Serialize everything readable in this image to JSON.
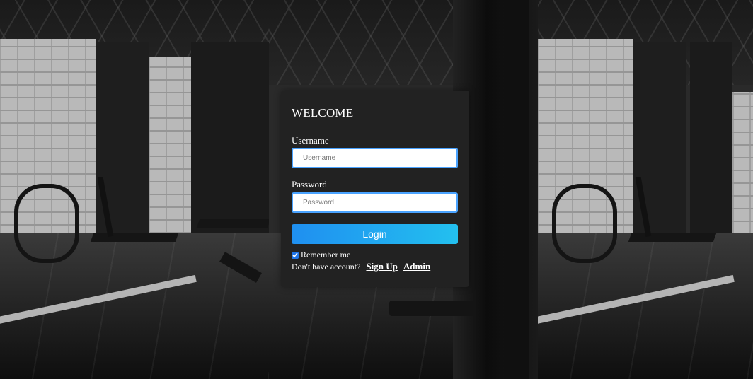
{
  "form": {
    "title": "WELCOME",
    "username_label": "Username",
    "username_placeholder": "Username",
    "password_label": "Password",
    "password_placeholder": "Password",
    "login_label": "Login",
    "remember_label": "Remember me",
    "remember_checked": true,
    "no_account_text": "Don't have account?",
    "signup_label": "Sign Up",
    "admin_label": "Admin"
  },
  "colors": {
    "card_bg": "#222222",
    "button_gradient_start": "#1f8ff0",
    "button_gradient_end": "#23c0ef",
    "input_border": "#4aa3ff"
  }
}
